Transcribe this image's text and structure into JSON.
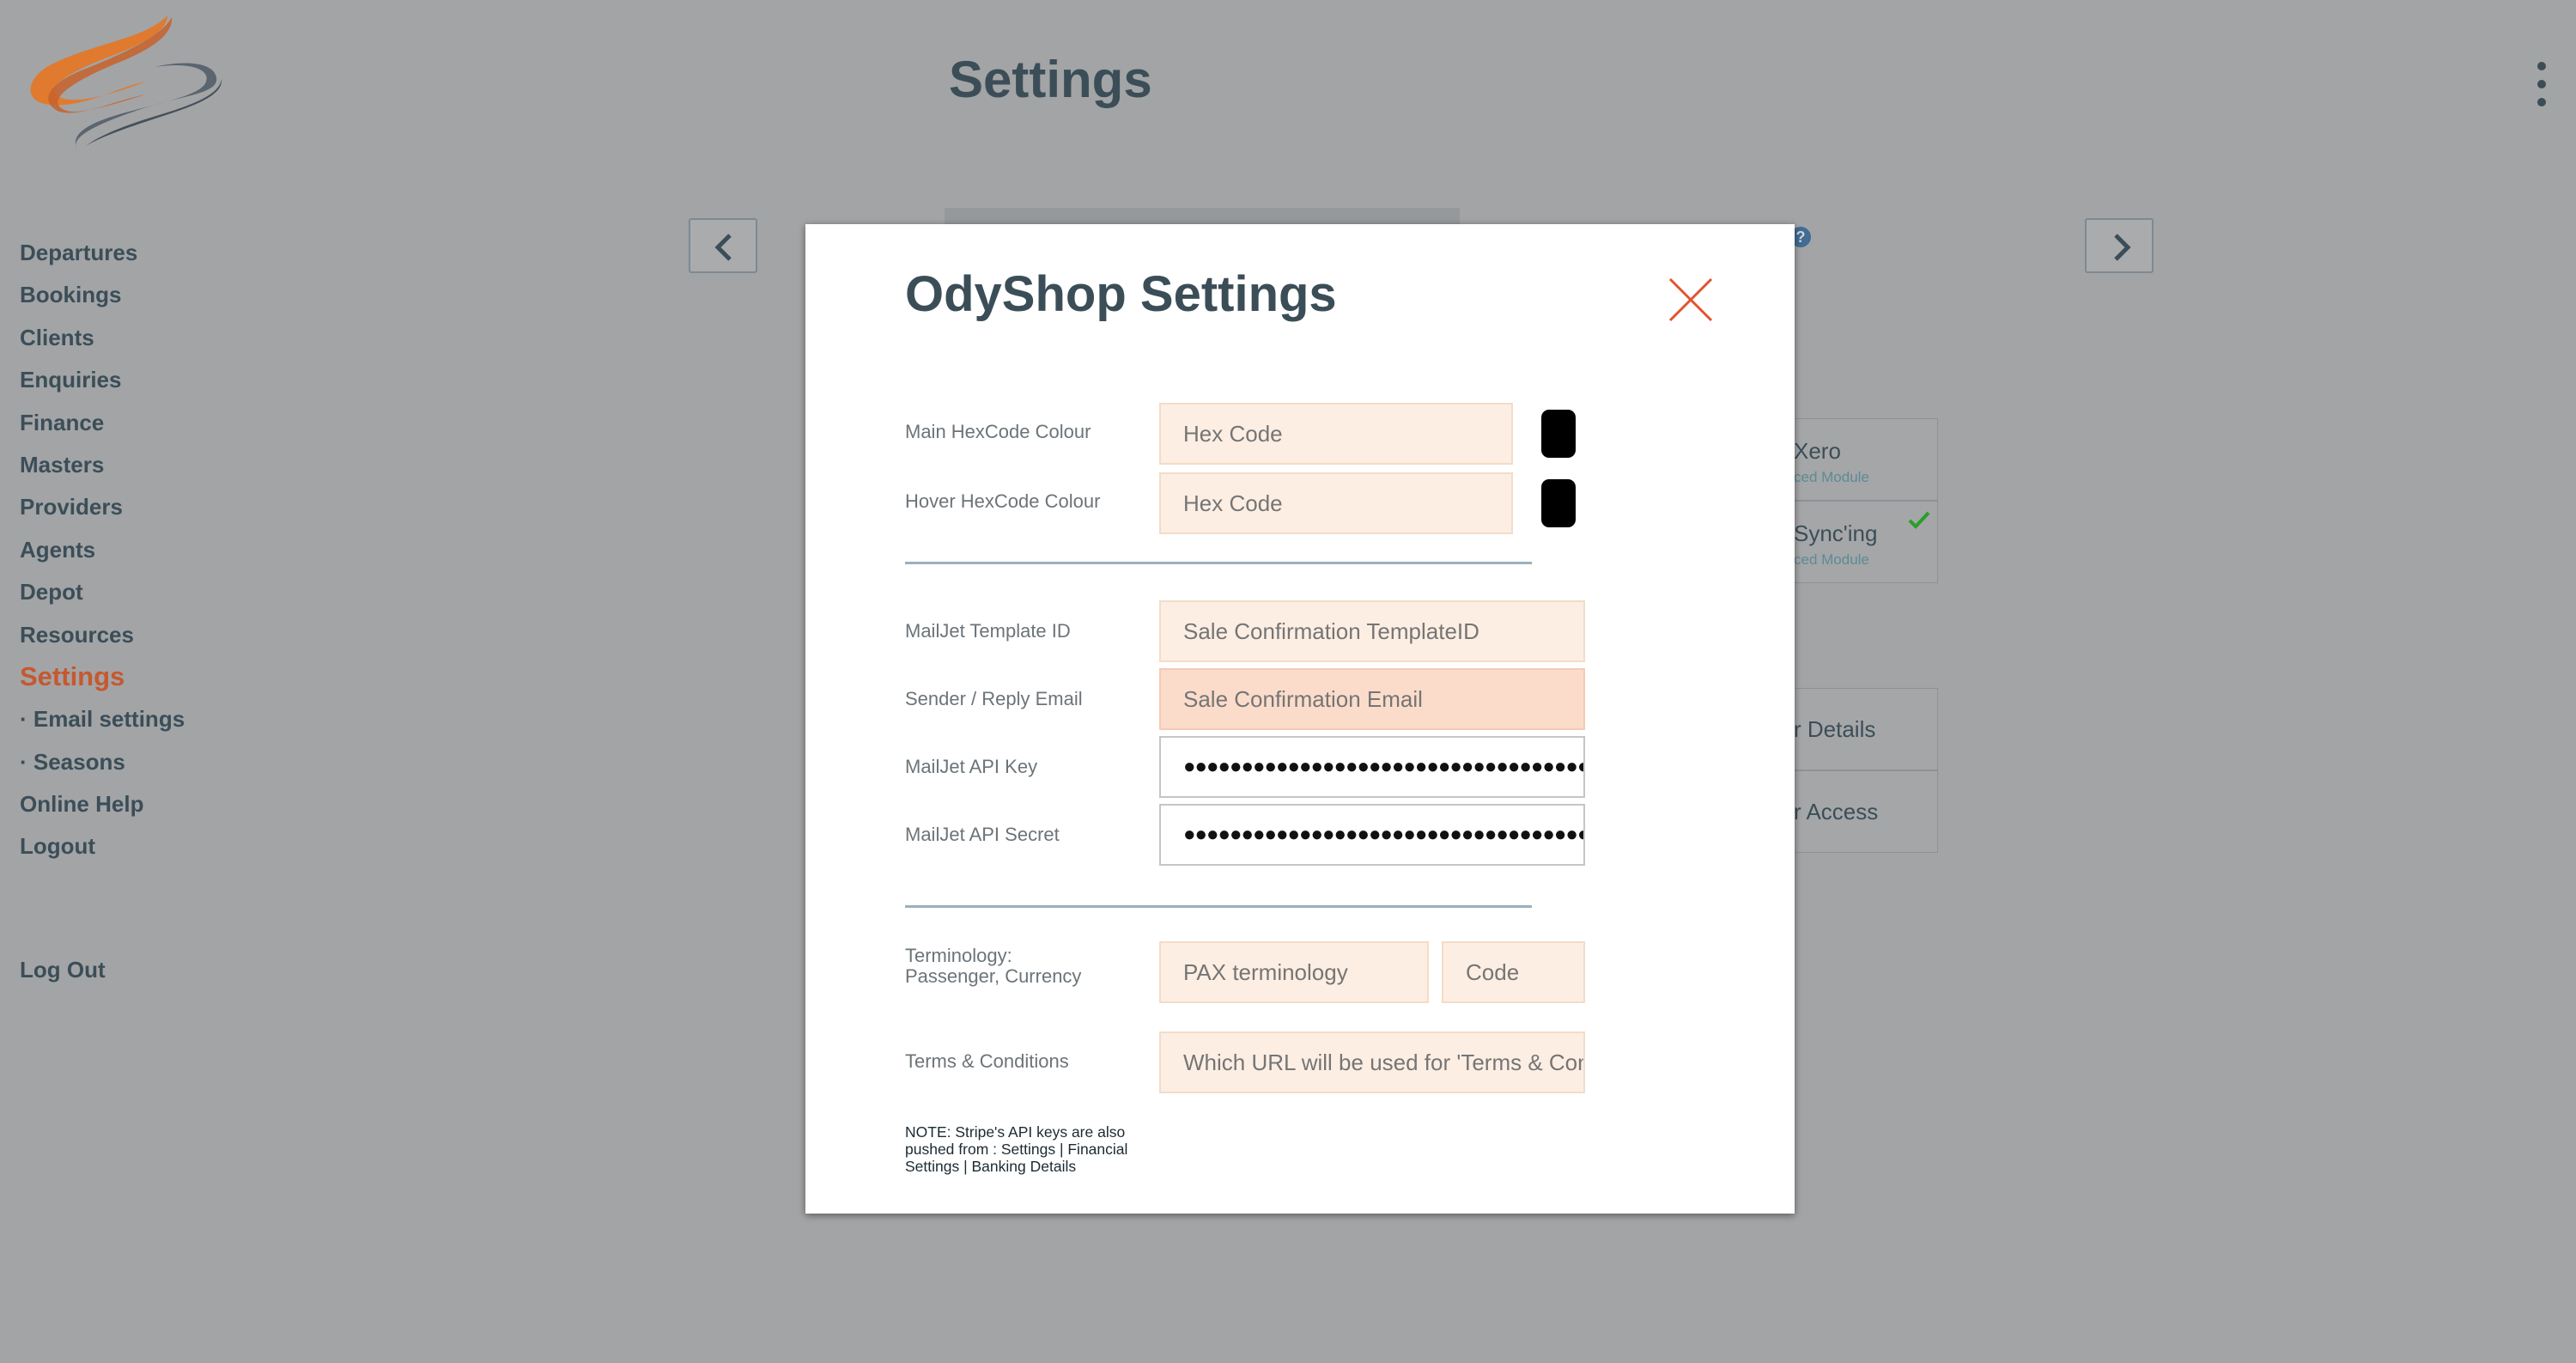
{
  "header": {
    "title": "Settings"
  },
  "sidebar": {
    "items": [
      {
        "label": "Departures"
      },
      {
        "label": "Bookings"
      },
      {
        "label": "Clients"
      },
      {
        "label": "Enquiries"
      },
      {
        "label": "Finance"
      },
      {
        "label": "Masters"
      },
      {
        "label": "Providers"
      },
      {
        "label": "Agents"
      },
      {
        "label": "Depot"
      },
      {
        "label": "Resources"
      },
      {
        "label": "Settings"
      },
      {
        "label": "· Email settings"
      },
      {
        "label": "· Seasons"
      },
      {
        "label": "Online Help"
      },
      {
        "label": "Logout"
      }
    ],
    "logout_label": "Log Out"
  },
  "background": {
    "help_icon_text": "?",
    "cards": [
      {
        "title": "Xero",
        "subtitle": "ced Module"
      },
      {
        "title": "Sync'ing",
        "subtitle": "ced Module"
      },
      {
        "title": "r Details"
      },
      {
        "title": "r Access"
      }
    ]
  },
  "modal": {
    "title": "OdyShop Settings",
    "fields": {
      "main_hex_label": "Main HexCode Colour",
      "main_hex_placeholder": "Hex Code",
      "main_hex_value": "",
      "main_hex_swatch": "#000000",
      "hover_hex_label": "Hover HexCode Colour",
      "hover_hex_placeholder": "Hex Code",
      "hover_hex_value": "",
      "hover_hex_swatch": "#000000",
      "template_label": "MailJet Template ID",
      "template_placeholder": "Sale Confirmation TemplateID",
      "email_label": "Sender / Reply Email",
      "email_placeholder": "Sale Confirmation Email",
      "api_key_label": "MailJet API Key",
      "api_key_masked": "●●●●●●●●●●●●●●●●●●●●●●●●●●●●●●●●●●●●●●●●",
      "api_secret_label": "MailJet API Secret",
      "api_secret_masked": "●●●●●●●●●●●●●●●●●●●●●●●●●●●●●●●●●●●●●●●●",
      "terminology_label_1": "Terminology:",
      "terminology_label_2": "Passenger, Currency",
      "pax_placeholder": "PAX terminology",
      "currency_placeholder": "Code",
      "terms_label": "Terms & Conditions",
      "terms_placeholder": "Which URL will be used for 'Terms & Conditions'"
    },
    "note": "NOTE: Stripe's API keys are also pushed from : Settings | Financial Settings | Banking Details"
  },
  "colors": {
    "nav_text": "#3b4e58",
    "active": "#c6582f",
    "close_icon": "#e2522f",
    "field_bg": "#fdeee3",
    "check": "#2a9d2a"
  },
  "icons": [
    "app-logo-icon",
    "kebab-menu-icon",
    "chevron-left-icon",
    "chevron-right-icon",
    "help-icon",
    "checkmark-icon",
    "close-icon"
  ]
}
